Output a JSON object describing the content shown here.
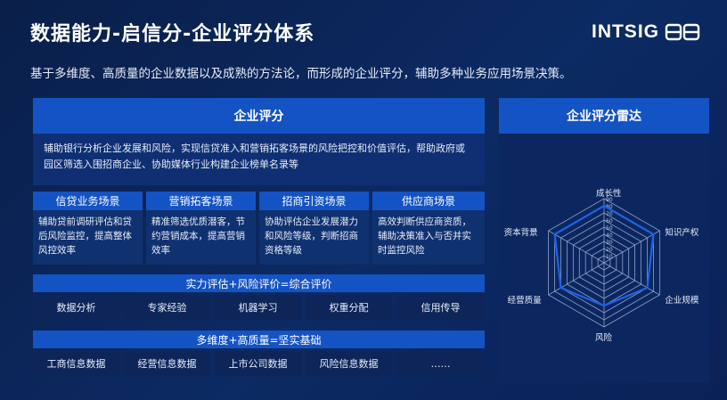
{
  "title": "数据能力-启信分-企业评分体系",
  "logo": {
    "text": "INTSIG",
    "icon": "intsig-logo-icon"
  },
  "subtitle": "基于多维度、高质量的企业数据以及成熟的方法论，而形成的企业评分，辅助多种业务应用场景决策。",
  "score_panel": {
    "title": "企业评分",
    "desc": "辅助银行分析企业发展和风险，实现信贷准入和营销拓客场景的风险把控和价值评估，帮助政府或园区筛选入围招商企业、协助媒体行业构建企业榜单名录等"
  },
  "scenarios": [
    {
      "title": "信贷业务场景",
      "desc": "辅助贷前调研评估和贷后风险监控，提高整体风控效率"
    },
    {
      "title": "营销拓客场景",
      "desc": "精准筛选优质潜客，节约营销成本，提高营销效率"
    },
    {
      "title": "招商引资场景",
      "desc": "协助评估企业发展潜力和风险等级，判断招商资格等级"
    },
    {
      "title": "供应商场景",
      "desc": "高效判断供应商资质，辅助决策准入与否并实时监控风险"
    }
  ],
  "method": {
    "title": "实力评估+风险评价=综合评价",
    "items": [
      "数据分析",
      "专家经验",
      "机器学习",
      "权重分配",
      "信用传导"
    ]
  },
  "foundation": {
    "title": "多维度+高质量=坚实基础",
    "items": [
      "工商信息数据",
      "经营信息数据",
      "上市公司数据",
      "风险信息数据",
      "……"
    ]
  },
  "radar": {
    "title": "企业评分雷达",
    "axes": [
      "成长性",
      "知识产权",
      "企业规模",
      "风险",
      "经营质量",
      "资本背景"
    ],
    "ticks": [
      "10",
      "20",
      "30",
      "40",
      "50",
      "60",
      "70",
      "80",
      "90"
    ],
    "max": 90,
    "values": [
      80,
      80,
      70,
      60,
      70,
      80
    ],
    "color": "#1e63e6"
  }
}
